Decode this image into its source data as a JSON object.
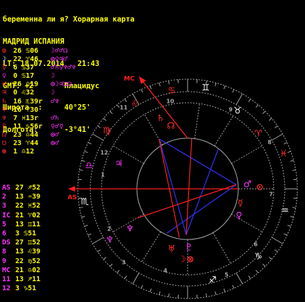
{
  "header": {
    "line1": "беременна ли я? Хорарная карта",
    "line2": "МАДРИД ИСПАНИЯ",
    "line3": "LT: 18.07.2014   21:43",
    "line4": "GMT: +2       Плацидус",
    "line5": "Широта  :     40°25'",
    "line6": "Долгота:      -3°41'"
  },
  "planets": [
    {
      "glyph": "⊙",
      "glyph_color": "#ff3030",
      "value": "26 ♋06",
      "aspects": [
        {
          "t": "☽",
          "c": "#ff33ff"
        },
        {
          "t": "♂",
          "c": "#ff33ff"
        },
        {
          "t": "♂",
          "c": "#ff33ff"
        },
        {
          "t": "☊",
          "c": "#ff33ff"
        }
      ]
    },
    {
      "glyph": "☽",
      "glyph_color": "#ffffff",
      "value": "22 ♈46",
      "aspects": [
        {
          "t": "⊙",
          "c": "#ff33ff"
        },
        {
          "t": "♀",
          "c": "#ff33ff"
        },
        {
          "t": "♃",
          "c": "#ff33ff"
        },
        {
          "t": "♂",
          "c": "#ff33ff"
        }
      ]
    },
    {
      "glyph": "☿",
      "glyph_color": "#ff3030",
      "value": "6 ♋37",
      "aspects": [
        {
          "t": "♂",
          "c": "#ff33ff"
        },
        {
          "t": "♄",
          "c": "#ff33ff"
        },
        {
          "t": "♀",
          "c": "#ff33ff"
        },
        {
          "t": "♆",
          "c": "#ff33ff"
        },
        {
          "t": "♂",
          "c": "#ff33ff"
        },
        {
          "t": "♆",
          "c": "#ff33ff"
        }
      ]
    },
    {
      "glyph": "♀",
      "glyph_color": "#ff33ff",
      "value": "0 ♋17",
      "aspects": [
        {
          "t": "☽",
          "c": "#ff33ff"
        }
      ]
    },
    {
      "glyph": "♂",
      "glyph_color": "#ff3030",
      "value": "26 ♎19",
      "aspects": [
        {
          "t": "⊙",
          "c": "#ff33ff"
        },
        {
          "t": "☽",
          "c": "#ff33ff"
        },
        {
          "t": "♃",
          "c": "#ff33ff"
        },
        {
          "t": "♊",
          "c": "#ff33ff"
        },
        {
          "t": "☊",
          "c": "#ff33ff"
        }
      ]
    },
    {
      "glyph": "♃",
      "glyph_color": "#ff3030",
      "value": "0 ♌32",
      "aspects": [
        {
          "t": "☽",
          "c": "#ff33ff"
        }
      ]
    },
    {
      "glyph": "♄",
      "glyph_color": "#ff3030",
      "value": "16 ♏39r",
      "aspects": [
        {
          "t": "♂",
          "c": "#ff33ff"
        },
        {
          "t": "♆",
          "c": "#ff33ff"
        }
      ]
    },
    {
      "glyph": "♅",
      "glyph_color": "#ff3030",
      "value": "16 ♈30",
      "aspects": []
    },
    {
      "glyph": "♆",
      "glyph_color": "#ff3030",
      "value": "7 ♓13r",
      "aspects": [
        {
          "t": "♂",
          "c": "#ff33ff"
        },
        {
          "t": "♄",
          "c": "#ff33ff"
        }
      ]
    },
    {
      "glyph": "♇",
      "glyph_color": "#ff3030",
      "value": "11 ♑56r",
      "aspects": [
        {
          "t": "♀",
          "c": "#ff33ff"
        },
        {
          "t": "♂",
          "c": "#ff33ff"
        },
        {
          "t": "☿",
          "c": "#ff33ff"
        }
      ]
    },
    {
      "glyph": "☊",
      "glyph_color": "#ff3030",
      "value": "23 ♎44",
      "aspects": [
        {
          "t": "⊙",
          "c": "#ff33ff"
        },
        {
          "t": "♂",
          "c": "#ff33ff"
        }
      ]
    },
    {
      "glyph": "☋",
      "glyph_color": "#ff3030",
      "value": "23 ♈44",
      "aspects": [
        {
          "t": "⊙",
          "c": "#ff33ff"
        },
        {
          "t": "♂",
          "c": "#ff33ff"
        }
      ]
    },
    {
      "glyph": "⊗",
      "glyph_color": "#ff3030",
      "value": "1 ♎12",
      "aspects": []
    }
  ],
  "houses": [
    {
      "label": "AS",
      "value": "27 ♐52"
    },
    {
      "label": "2",
      "value": "13 ♒39"
    },
    {
      "label": "3",
      "value": "22 ♓52"
    },
    {
      "label": "IC",
      "value": "21 ♈02"
    },
    {
      "label": "5",
      "value": "13 ♊11"
    },
    {
      "label": "6",
      "value": "3 ♋51"
    },
    {
      "label": "DS",
      "value": "27 ♊52"
    },
    {
      "label": "8",
      "value": "13 ♌39"
    },
    {
      "label": "9",
      "value": "22 ♍52"
    },
    {
      "label": "MC",
      "value": "21 ♎02"
    },
    {
      "label": "11",
      "value": "13 ♐11"
    },
    {
      "label": "12",
      "value": "3 ♑51"
    }
  ],
  "wheel": {
    "asc_label": "AS",
    "mc_label": "MC",
    "house_numbers": [
      "1",
      "2",
      "3",
      "4",
      "5",
      "6",
      "7",
      "8",
      "9",
      "10",
      "11",
      "12"
    ],
    "zodiac": [
      "♐",
      "♑",
      "♒",
      "♓",
      "♈",
      "♉",
      "♊",
      "♋",
      "♌",
      "♍",
      "♎",
      "♏"
    ],
    "planet_glyphs": [
      "♄",
      "☊",
      "♃",
      "♂",
      "⊙",
      "☿",
      "♀",
      "♆",
      "☽",
      "♅",
      "♇",
      "⊗",
      "♆"
    ],
    "colors": {
      "background": "#000000",
      "text": "#ffffff",
      "value": "#ffff00",
      "house_label": "#ff33ff",
      "planet_red": "#ff3030",
      "planet_violet": "#ff33ff",
      "aspect_red": "#ff2020",
      "aspect_blue": "#3333ff",
      "ring": "#aaaaaa"
    }
  }
}
